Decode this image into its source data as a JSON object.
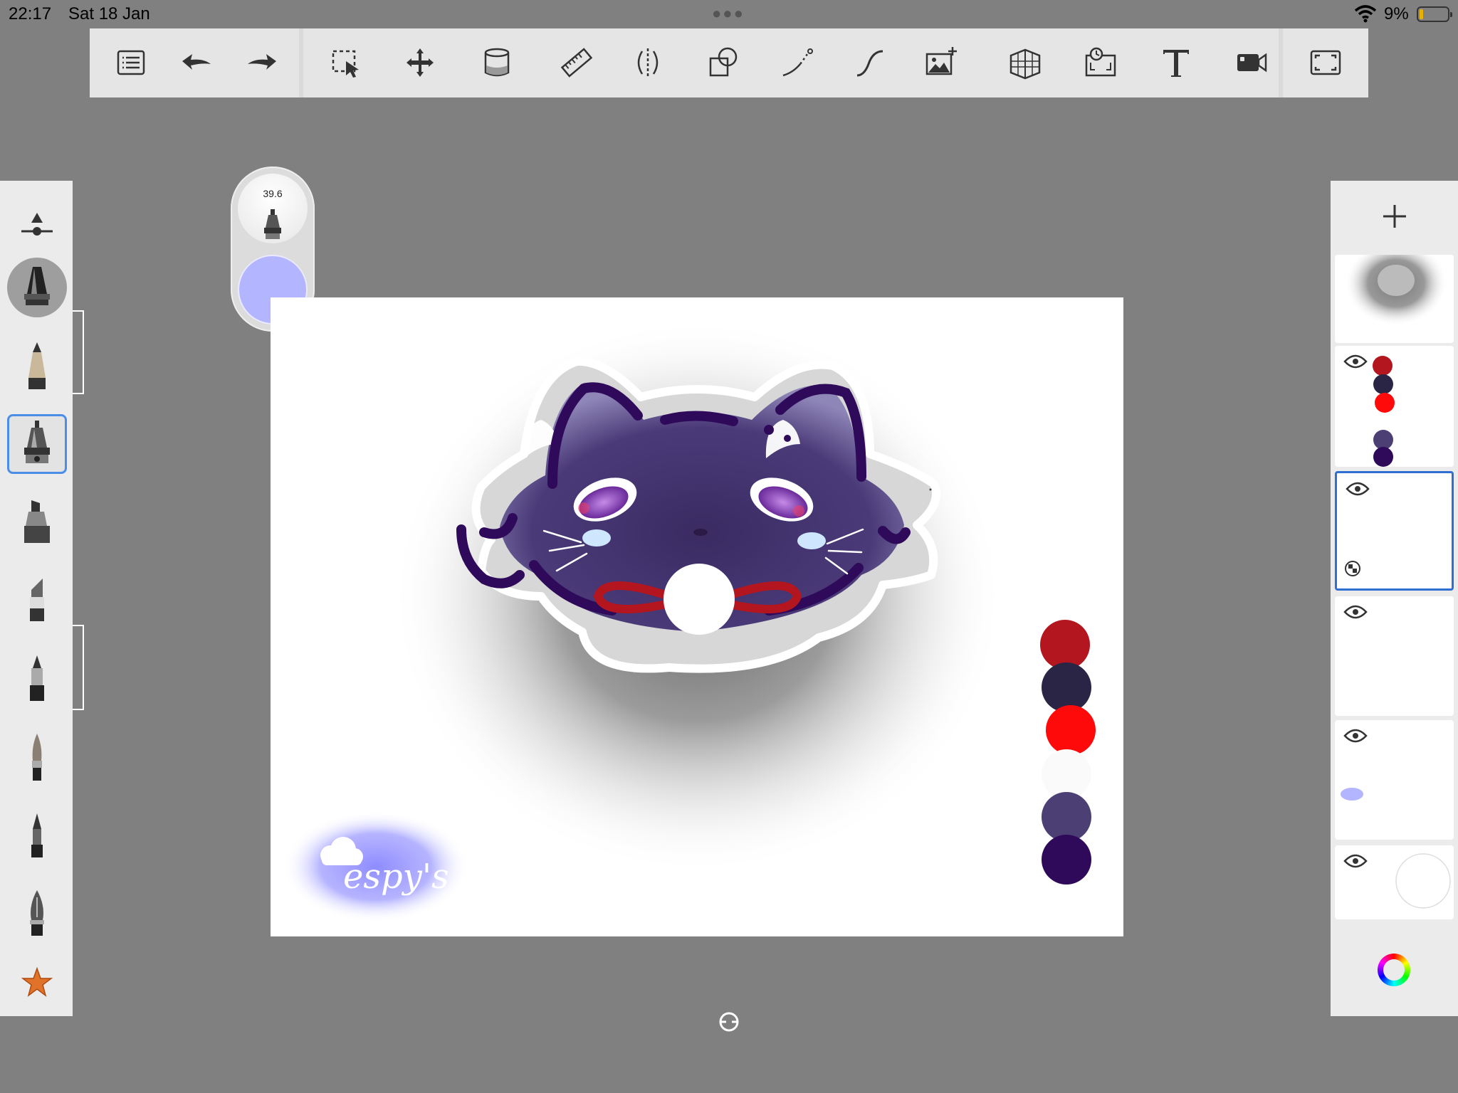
{
  "status_bar": {
    "time": "22:17",
    "date": "Sat 18 Jan",
    "battery": "9%"
  },
  "toolbar": {
    "items": [
      "menu-icon",
      "undo-icon",
      "redo-icon",
      "selection-icon",
      "transform-icon",
      "fill-bucket-icon",
      "ruler-icon",
      "symmetry-icon",
      "shapes-icon",
      "predictive-stroke-icon",
      "steady-stroke-icon",
      "add-image-icon",
      "perspective-grid-icon",
      "time-lapse-icon",
      "text-icon",
      "record-icon",
      "fullscreen-icon"
    ]
  },
  "brushes": {
    "items": [
      "brush-size-slider",
      "airbrush",
      "pencil",
      "technical-pen",
      "marker",
      "chisel-marker",
      "fineliner",
      "paint-brush",
      "ink-pen",
      "fountain-pen",
      "favorites-star"
    ],
    "active": "technical-pen"
  },
  "brush_puck": {
    "size_value": "39.6",
    "current_color": "#b3b5ff"
  },
  "canvas": {
    "signature_text": "espy's",
    "palette": [
      "#b3161f",
      "#2b2545",
      "#ff0a0a",
      "#fafafa",
      "#4c3f73",
      "#2f0a5a"
    ]
  },
  "layers": {
    "add_label": "+",
    "items": [
      {
        "name": "shadow-layer",
        "visible": true
      },
      {
        "name": "palette-layer",
        "visible": true
      },
      {
        "name": "selected-empty-layer",
        "visible": true,
        "selected": true
      },
      {
        "name": "empty-layer",
        "visible": true
      },
      {
        "name": "signature-layer",
        "visible": true
      },
      {
        "name": "background-layer",
        "visible": true
      }
    ]
  }
}
